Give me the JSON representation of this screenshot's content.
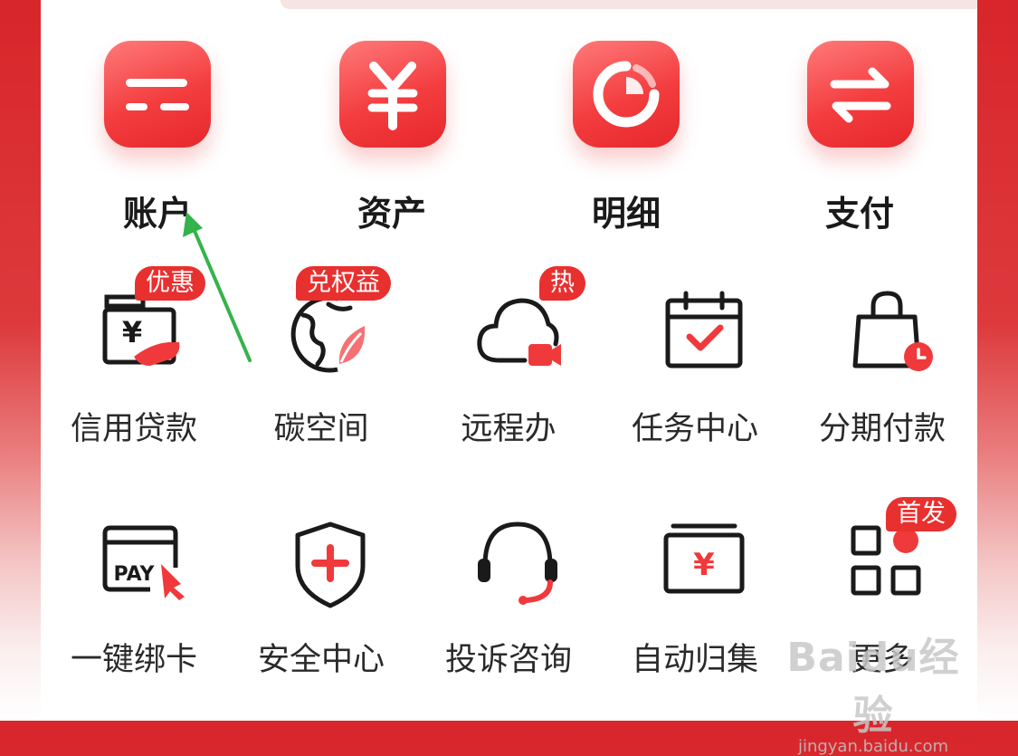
{
  "top_features": [
    {
      "label": "账户",
      "icon": "account-icon"
    },
    {
      "label": "资产",
      "icon": "yuan-icon"
    },
    {
      "label": "明细",
      "icon": "pie-chart-icon"
    },
    {
      "label": "支付",
      "icon": "transfer-icon"
    }
  ],
  "grid": [
    {
      "label": "信用贷款",
      "icon": "loan-icon",
      "badge": "优惠"
    },
    {
      "label": "碳空间",
      "icon": "globe-leaf-icon",
      "badge": "兑权益"
    },
    {
      "label": "远程办",
      "icon": "cloud-video-icon",
      "badge": "热"
    },
    {
      "label": "任务中心",
      "icon": "calendar-check-icon",
      "badge": ""
    },
    {
      "label": "分期付款",
      "icon": "shopping-bag-clock-icon",
      "badge": ""
    },
    {
      "label": "一键绑卡",
      "icon": "pay-card-icon",
      "badge": ""
    },
    {
      "label": "安全中心",
      "icon": "shield-icon",
      "badge": ""
    },
    {
      "label": "投诉咨询",
      "icon": "headset-icon",
      "badge": ""
    },
    {
      "label": "自动归集",
      "icon": "yuan-box-icon",
      "badge": ""
    },
    {
      "label": "更多",
      "icon": "more-grid-icon",
      "badge": "首发"
    }
  ],
  "pay_card_text": "PAY",
  "watermark": {
    "logo": "Baidu经验",
    "url": "jingyan.baidu.com"
  },
  "colors": {
    "accent": "#e8302f",
    "background_red": "#d8262b",
    "annotation_arrow": "#35b34a"
  }
}
